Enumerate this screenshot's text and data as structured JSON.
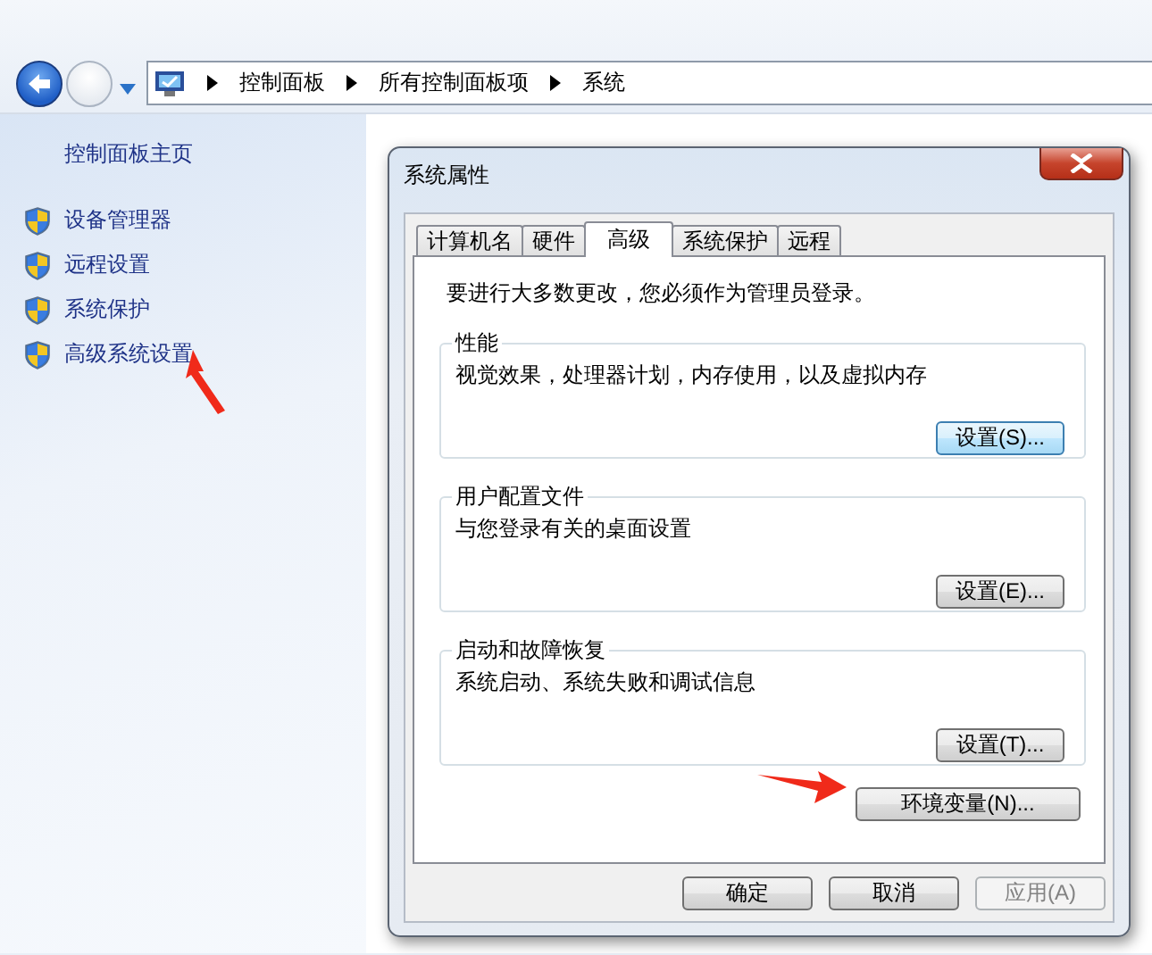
{
  "address_bar": {
    "breadcrumbs": [
      "控制面板",
      "所有控制面板项",
      "系统"
    ]
  },
  "sidebar": {
    "home": "控制面板主页",
    "items": [
      {
        "label": "设备管理器"
      },
      {
        "label": "远程设置"
      },
      {
        "label": "系统保护"
      },
      {
        "label": "高级系统设置"
      }
    ]
  },
  "dialog": {
    "title": "系统属性",
    "tabs": [
      {
        "label": "计算机名",
        "selected": false
      },
      {
        "label": "硬件",
        "selected": false
      },
      {
        "label": "高级",
        "selected": true
      },
      {
        "label": "系统保护",
        "selected": false
      },
      {
        "label": "远程",
        "selected": false
      }
    ],
    "notice": "要进行大多数更改，您必须作为管理员登录。",
    "groups": [
      {
        "title": "性能",
        "description": "视觉效果，处理器计划，内存使用，以及虚拟内存",
        "button": "设置(S)...",
        "focused": true
      },
      {
        "title": "用户配置文件",
        "description": "与您登录有关的桌面设置",
        "button": "设置(E)...",
        "focused": false
      },
      {
        "title": "启动和故障恢复",
        "description": "系统启动、系统失败和调试信息",
        "button": "设置(T)...",
        "focused": false
      }
    ],
    "env_button": "环境变量(N)...",
    "buttons": [
      {
        "label": "确定",
        "disabled": false
      },
      {
        "label": "取消",
        "disabled": false
      },
      {
        "label": "应用(A)",
        "disabled": true
      }
    ]
  },
  "annotations": [
    {
      "kind": "arrow"
    },
    {
      "kind": "arrow"
    }
  ]
}
